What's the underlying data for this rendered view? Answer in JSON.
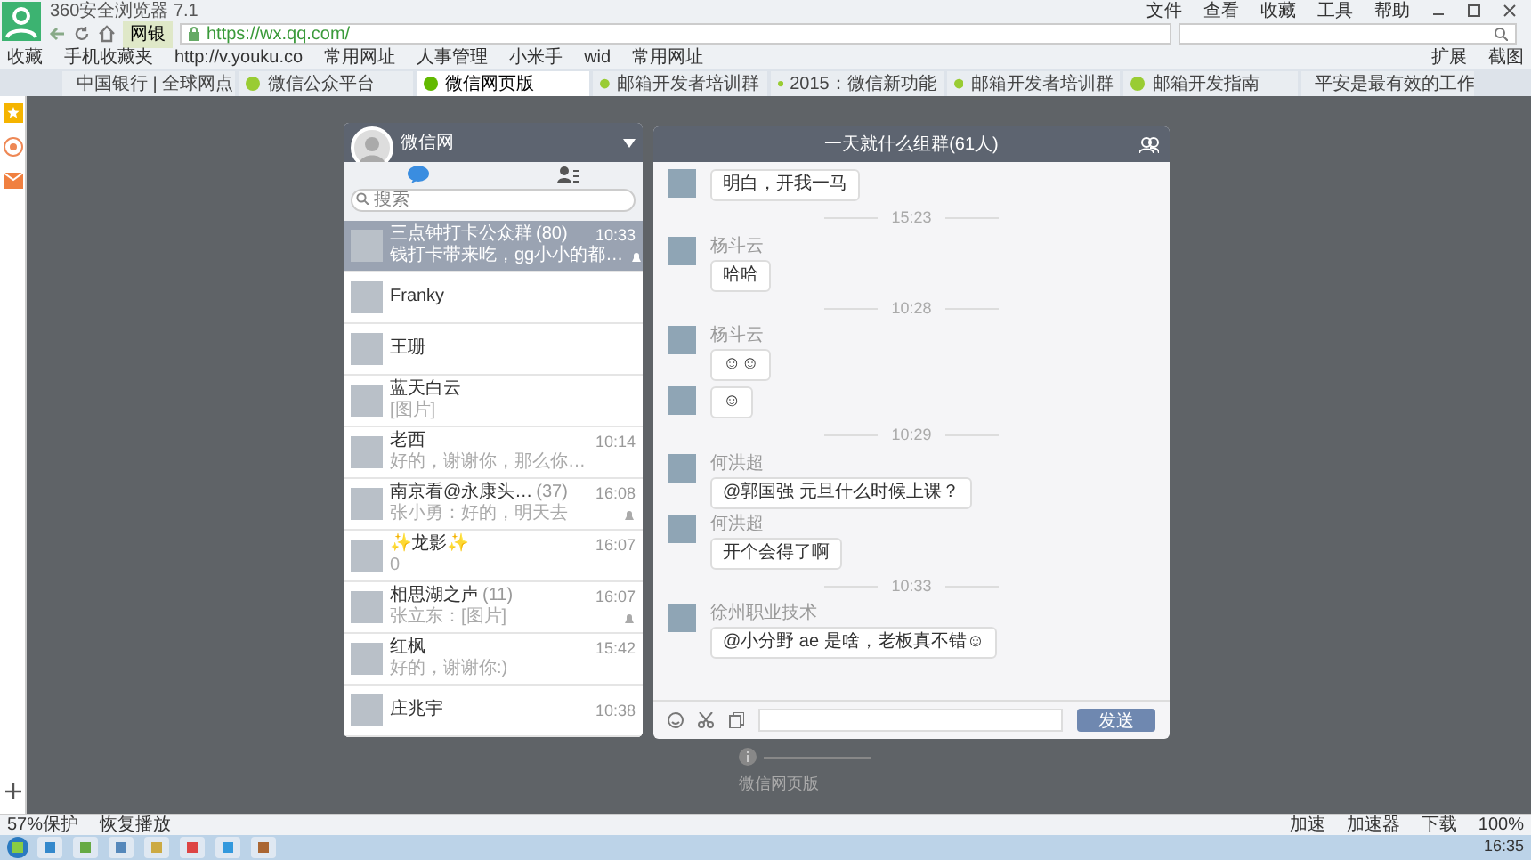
{
  "browser": {
    "title": "360安全浏览器 7.1",
    "menu": [
      "文件",
      "查看",
      "收藏",
      "工具",
      "帮助"
    ],
    "address": "https://wx.qq.com/",
    "bank_button": "网银",
    "bookmarks": [
      "收藏",
      "手机收藏夹",
      "http://v.youku.co",
      "常用网址",
      "人事管理",
      "小米手",
      "wid",
      "常用网址"
    ],
    "bookmarks_right": [
      "扩展",
      "截图"
    ],
    "zoom": "100%",
    "tabs": [
      {
        "label": "中国银行 | 全球网点",
        "selected": false
      },
      {
        "label": "微信公众平台",
        "selected": false
      },
      {
        "label": "微信网页版",
        "selected": true
      },
      {
        "label": "邮箱开发者培训群",
        "selected": false
      },
      {
        "label": "2015：微信新功能",
        "selected": false
      },
      {
        "label": "邮箱开发者培训群",
        "selected": false
      },
      {
        "label": "邮箱开发指南",
        "selected": false
      },
      {
        "label": "平安是最有效的工作",
        "selected": false
      }
    ]
  },
  "wechat": {
    "user": "微信网",
    "search": {
      "placeholder": "搜索"
    },
    "chats": [
      {
        "name": "三点钟打卡公众群",
        "count": "(80)",
        "time": "10:33",
        "preview": "钱打卡带来吃，gg小小的都…",
        "muted": true,
        "selected": true
      },
      {
        "name": "Franky",
        "muted": false,
        "selected": false
      },
      {
        "name": "王珊",
        "muted": false,
        "selected": false
      },
      {
        "name": "蓝天白云",
        "preview": "[图片]",
        "muted": false,
        "selected": false
      },
      {
        "name": "老西",
        "time": "10:14",
        "preview": "好的，谢谢你，那么你…",
        "muted": false,
        "selected": false
      },
      {
        "name": "南京看@永康头…",
        "count": "(37)",
        "time": "16:08",
        "preview": "张小勇：好的，明天去",
        "muted": true,
        "selected": false
      },
      {
        "name": "✨龙影✨",
        "time": "16:07",
        "preview": "0",
        "muted": false,
        "selected": false
      },
      {
        "name": "相思湖之声",
        "count": "(11)",
        "time": "16:07",
        "preview": "张立东：[图片]",
        "muted": true,
        "selected": false
      },
      {
        "name": "红枫",
        "time": "15:42",
        "preview": "好的，谢谢你:)",
        "muted": false,
        "selected": false
      },
      {
        "name": "庄兆宇",
        "time": "10:38",
        "muted": false,
        "selected": false
      }
    ],
    "chat_title": "一天就什么组群(61人)",
    "messages": [
      {
        "kind": "message",
        "text": "明白，开我一马"
      },
      {
        "kind": "time",
        "text": "15:23"
      },
      {
        "kind": "message",
        "sender": "杨斗云",
        "text": "哈哈"
      },
      {
        "kind": "time",
        "text": "10:28"
      },
      {
        "kind": "message",
        "sender": "杨斗云",
        "text": "☺☺"
      },
      {
        "kind": "message",
        "text": "☺"
      },
      {
        "kind": "time",
        "text": "10:29"
      },
      {
        "kind": "message",
        "sender": "何洪超",
        "text": "@郭国强 元旦什么时候上课？"
      },
      {
        "kind": "message",
        "sender": "何洪超",
        "text": "开个会得了啊"
      },
      {
        "kind": "time",
        "text": "10:33"
      },
      {
        "kind": "message",
        "sender": "徐州职业技术",
        "text": "@小分野 ae 是啥，老板真不错☺"
      }
    ],
    "send_button": "发送",
    "footer": "微信网页版"
  },
  "status_bar": {
    "left": [
      "57%保护",
      "恢复播放"
    ],
    "right": [
      "加速",
      "加速器",
      "下载"
    ]
  },
  "taskbar": {
    "clock": "16:35"
  }
}
